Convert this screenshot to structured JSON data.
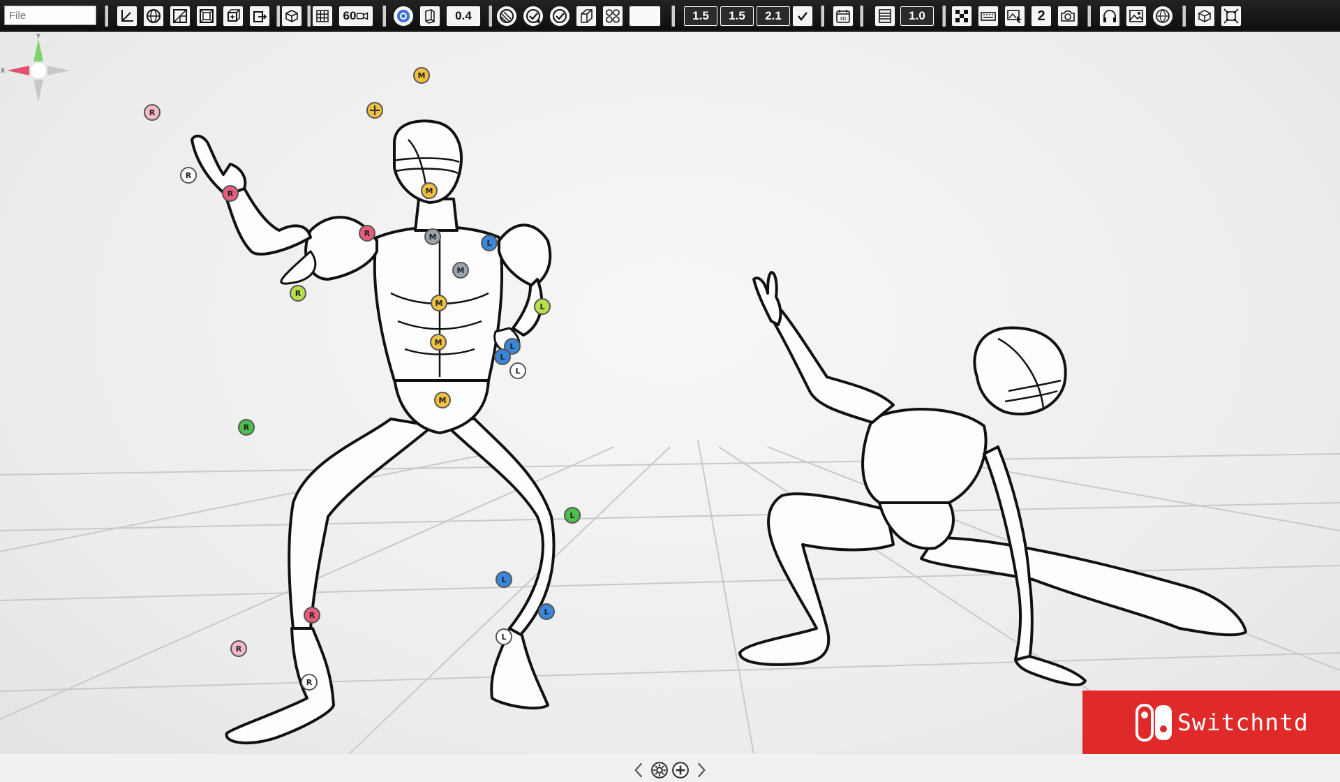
{
  "toolbar": {
    "file_placeholder": "File",
    "fps_value": "60",
    "opacity_value": "0.4",
    "scale_values": [
      "1.5",
      "1.5",
      "2.1"
    ],
    "camera_value": "1.0",
    "page_badge": "2",
    "cube_badge": "3D",
    "icons": [
      "axis-icon",
      "globe-icon",
      "perspective-icon",
      "box-frame-icon",
      "box-move-icon",
      "box-arrow-icon",
      "cube-icon",
      "grid-icon",
      "video-camera-icon",
      "target-icon",
      "page-flip-icon",
      "lens-icon",
      "check-group-icon",
      "check-circle-icon",
      "box-outline-icon",
      "joints-icon",
      "calendar-3d-icon",
      "film-icon",
      "checker-icon",
      "keyboard-icon",
      "picture-cursor-icon",
      "counter-icon",
      "camera-icon",
      "headphones-icon",
      "image-icon",
      "www-icon",
      "box-number-icon",
      "fullscreen-icon"
    ]
  },
  "markers": {
    "right": "R",
    "left": "L",
    "middle": "M"
  },
  "gizmo": {
    "y_label": "Y",
    "x_label": "X"
  },
  "watermark": {
    "text": "Switchntd"
  },
  "colors": {
    "right_marker": "#e65c7a",
    "left_marker": "#3a86d8",
    "middle_marker": "#f0c040",
    "green_marker": "#4dbf4d",
    "lime_marker": "#b6e04a",
    "watermark_bg": "#e02a2a"
  }
}
